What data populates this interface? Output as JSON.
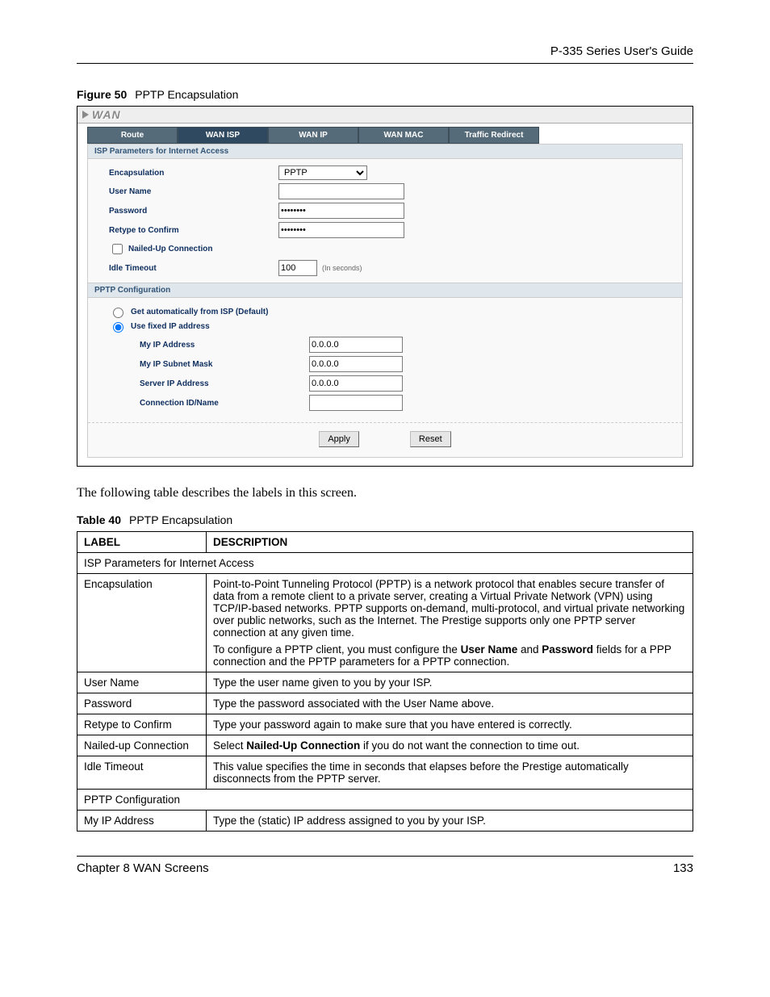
{
  "header": {
    "guide_title": "P-335 Series User's Guide"
  },
  "figure": {
    "number": "Figure 50",
    "title": "PPTP Encapsulation"
  },
  "screenshot": {
    "window_title": "WAN",
    "tabs": [
      "Route",
      "WAN ISP",
      "WAN IP",
      "WAN MAC",
      "Traffic Redirect"
    ],
    "active_tab_index": 1,
    "section1_title": "ISP Parameters for Internet Access",
    "labels": {
      "encapsulation": "Encapsulation",
      "user_name": "User Name",
      "password": "Password",
      "retype": "Retype to Confirm",
      "nailed_up": "Nailed-Up Connection",
      "idle_timeout": "Idle Timeout",
      "idle_unit": "(In seconds)"
    },
    "values": {
      "encapsulation_selected": "PPTP",
      "user_name": "",
      "password": "********",
      "retype": "********",
      "nailed_up_checked": false,
      "idle_timeout": "100"
    },
    "section2_title": "PPTP Configuration",
    "radio": {
      "auto_label": "Get automatically from ISP (Default)",
      "fixed_label": "Use fixed IP address",
      "selected": "fixed"
    },
    "pptp_labels": {
      "my_ip": "My IP Address",
      "my_mask": "My IP Subnet Mask",
      "server_ip": "Server IP Address",
      "conn_id": "Connection ID/Name"
    },
    "pptp_values": {
      "my_ip": "0.0.0.0",
      "my_mask": "0.0.0.0",
      "server_ip": "0.0.0.0",
      "conn_id": ""
    },
    "buttons": {
      "apply": "Apply",
      "reset": "Reset"
    }
  },
  "paragraph": "The following table describes the labels in this screen.",
  "table": {
    "number": "Table 40",
    "title": "PPTP Encapsulation",
    "head_label": "LABEL",
    "head_desc": "DESCRIPTION",
    "span1": "ISP Parameters for Internet Access",
    "rows": {
      "encap": {
        "label": "Encapsulation",
        "p1": "Point-to-Point Tunneling Protocol (PPTP) is a network protocol that enables secure transfer of data from a remote client to a private server, creating a Virtual Private Network (VPN) using TCP/IP-based networks. PPTP supports on-demand, multi-protocol, and virtual private networking over public networks, such as the Internet. The Prestige supports only one PPTP server connection at any given time.",
        "p2a": "To configure a PPTP client, you must configure the ",
        "p2b": "User Name",
        "p2c": " and ",
        "p2d": "Password",
        "p2e": " fields for a PPP connection and the PPTP parameters for a PPTP connection."
      },
      "user_name": {
        "label": "User Name",
        "desc": "Type the user name given to you by your ISP."
      },
      "password": {
        "label": "Password",
        "desc": "Type the password associated with the User Name above."
      },
      "retype": {
        "label": "Retype to Confirm",
        "desc": "Type your password again to make sure that you have entered is correctly."
      },
      "nailed": {
        "label": "Nailed-up Connection",
        "d_a": "Select ",
        "d_b": "Nailed-Up Connection",
        "d_c": " if you do not want the connection to time out."
      },
      "idle": {
        "label": "Idle Timeout",
        "desc": "This value specifies the time in seconds that elapses before the Prestige automatically disconnects from the PPTP server."
      },
      "pptp_span": "PPTP Configuration",
      "my_ip": {
        "label": "My IP Address",
        "desc": "Type the (static) IP address assigned to you by your ISP."
      }
    }
  },
  "footer": {
    "left": "Chapter 8 WAN Screens",
    "right": "133"
  }
}
